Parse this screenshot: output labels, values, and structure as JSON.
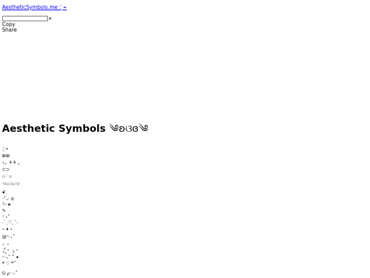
{
  "header": {
    "site_link": "AestheticSymbols.me : ̗̀➛"
  },
  "search": {
    "placeholder": "",
    "clear_label": "x"
  },
  "actions": {
    "copy_label": "Copy",
    "share_label": "Share"
  },
  "page": {
    "title": "Aesthetic Symbols",
    "title_symbol": "༄ʚଓɞ༄"
  },
  "symbols": [
    ": ̗̀➛",
    "⊞⊞",
    "⋆｡ ⚘⚘ ｡",
    "⊂⊃",
    "ʚ♡ɞ",
    "༄ʚଓɞ༄",
    "ꗃ.",
    "⋅˚₊‧ ଳ",
    "╰┈➤",
    "✎",
    "⁺ ˖˚",
    "˗ˋˏ♡ˎˊ˗",
    "⋆ ⏵ ⋆",
    "@⁺‧₊˚",
    "˚ ༘ ˚",
    "⋆｡˚ ☽ ˚",
    "⁺‧₊˚ ˚ ✦",
    "❝ ♡ ❞˚",
    "ଘ ℘ ‧₊˚"
  ]
}
